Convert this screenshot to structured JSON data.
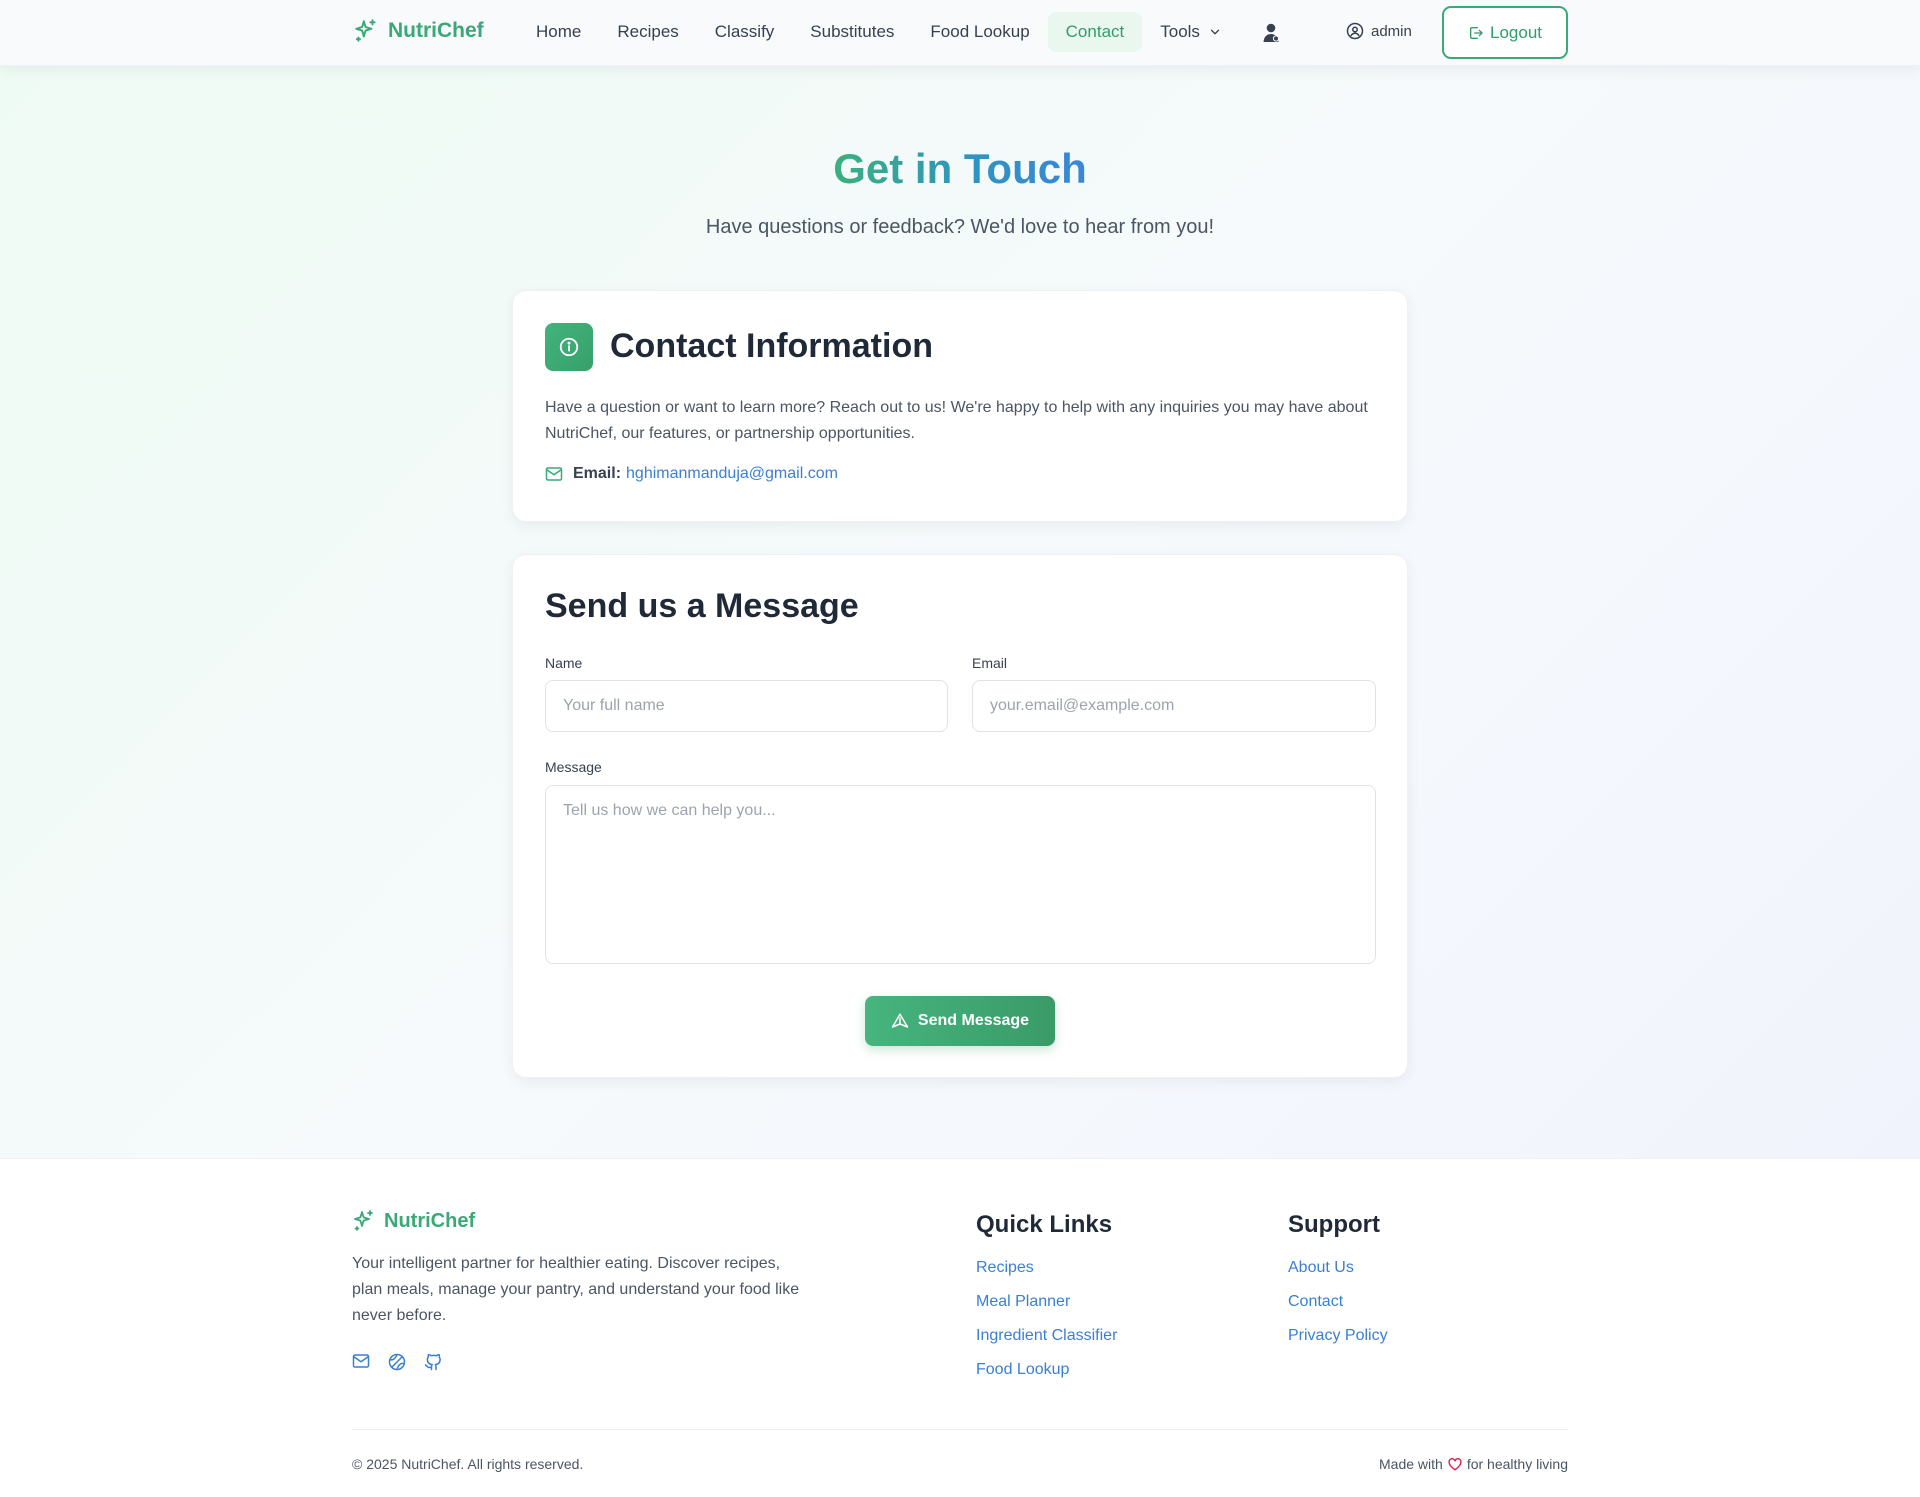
{
  "nav": {
    "brand": "NutriChef",
    "links": [
      "Home",
      "Recipes",
      "Classify",
      "Substitutes",
      "Food Lookup",
      "Contact"
    ],
    "active": "Contact",
    "tools_label": "Tools",
    "username": "admin",
    "logout_label": "Logout"
  },
  "hero": {
    "title": "Get in Touch",
    "subtitle": "Have questions or feedback? We'd love to hear from you!"
  },
  "contact_info": {
    "title": "Contact Information",
    "text": "Have a question or want to learn more? Reach out to us! We're happy to help with any inquiries you may have about NutriChef, our features, or partnership opportunities.",
    "email_label": "Email:",
    "email_value": "hghimanmanduja@gmail.com"
  },
  "message_form": {
    "title": "Send us a Message",
    "name_label": "Name",
    "name_placeholder": "Your full name",
    "email_label": "Email",
    "email_placeholder": "your.email@example.com",
    "message_label": "Message",
    "message_placeholder": "Tell us how we can help you...",
    "submit_label": "Send Message"
  },
  "footer": {
    "brand": "NutriChef",
    "description": "Your intelligent partner for healthier eating. Discover recipes, plan meals, manage your pantry, and understand your food like never before.",
    "social_icons": [
      "mail-icon",
      "globe-icon",
      "github-icon"
    ],
    "quick_links_title": "Quick Links",
    "quick_links": [
      "Recipes",
      "Meal Planner",
      "Ingredient Classifier",
      "Food Lookup"
    ],
    "support_title": "Support",
    "support_links": [
      "About Us",
      "Contact",
      "Privacy Policy"
    ],
    "copyright": "© 2025 NutriChef. All rights reserved.",
    "made_with_prefix": "Made with",
    "made_with_suffix": "for healthy living"
  },
  "colors": {
    "brand_green": "#3aa877",
    "link_blue": "#3a7fd4",
    "heart_red": "#e11d48"
  }
}
